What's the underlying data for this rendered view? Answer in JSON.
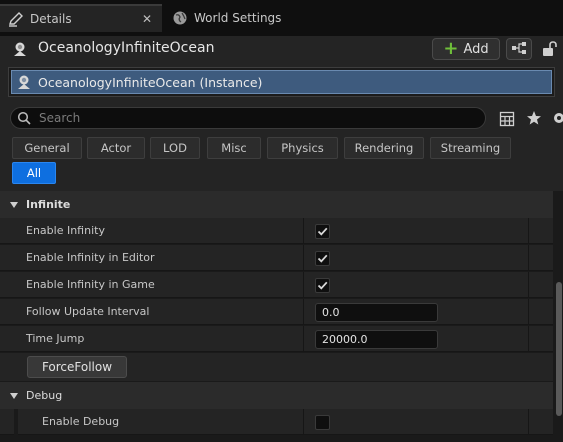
{
  "tabs": [
    {
      "label": "Details",
      "icon": "details-pencil-icon",
      "active": true
    },
    {
      "label": "World Settings",
      "icon": "globe-icon",
      "active": false
    }
  ],
  "header": {
    "actor_name": "OceanologyInfiniteOcean",
    "add_label": "Add",
    "selected_component": "OceanologyInfiniteOcean (Instance)"
  },
  "search": {
    "placeholder": "Search"
  },
  "filters": [
    "General",
    "Actor",
    "LOD",
    "Misc",
    "Physics",
    "Rendering",
    "Streaming",
    "All"
  ],
  "active_filter": "All",
  "categories": {
    "infinite": {
      "label": "Infinite",
      "rows": [
        {
          "name": "Enable Infinity",
          "type": "checkbox",
          "checked": true
        },
        {
          "name": "Enable Infinity in Editor",
          "type": "checkbox",
          "checked": true
        },
        {
          "name": "Enable Infinity in Game",
          "type": "checkbox",
          "checked": true
        },
        {
          "name": "Follow Update Interval",
          "type": "number",
          "value": "0.0"
        },
        {
          "name": "Time Jump",
          "type": "number",
          "value": "20000.0"
        }
      ],
      "button_label": "ForceFollow"
    },
    "debug": {
      "label": "Debug",
      "rows": [
        {
          "name": "Enable Debug",
          "type": "checkbox",
          "checked": false
        }
      ]
    }
  },
  "colors": {
    "accent": "#0e6fe0",
    "selection": "#3e5b7e",
    "add_plus": "#6fbf3a"
  }
}
